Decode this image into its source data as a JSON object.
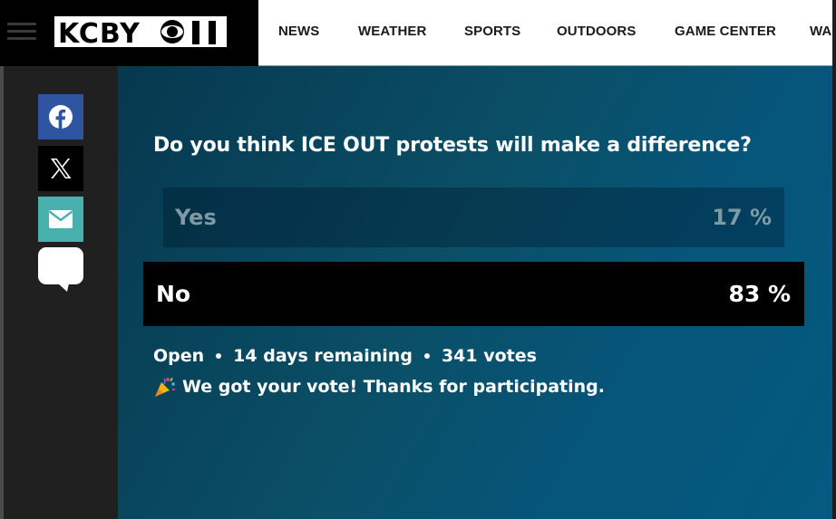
{
  "header": {
    "logo_text": "KCBY 11",
    "nav": [
      "NEWS",
      "WEATHER",
      "SPORTS",
      "OUTDOORS",
      "GAME CENTER",
      "WA"
    ]
  },
  "share": {
    "icons": [
      "facebook-icon",
      "x-icon",
      "email-icon",
      "comment-icon"
    ],
    "colors": {
      "facebook": "#2d55a1",
      "x": "#000000",
      "email": "#49b1ad"
    }
  },
  "poll": {
    "question": "Do you think ICE OUT protests will make a difference?",
    "options": [
      {
        "label": "Yes",
        "percent": "17 %"
      },
      {
        "label": "No",
        "percent": "83 %"
      }
    ],
    "status": "Open",
    "remaining": "14 days remaining",
    "votes": "341 votes",
    "thanks": "We got your vote! Thanks for participating."
  }
}
